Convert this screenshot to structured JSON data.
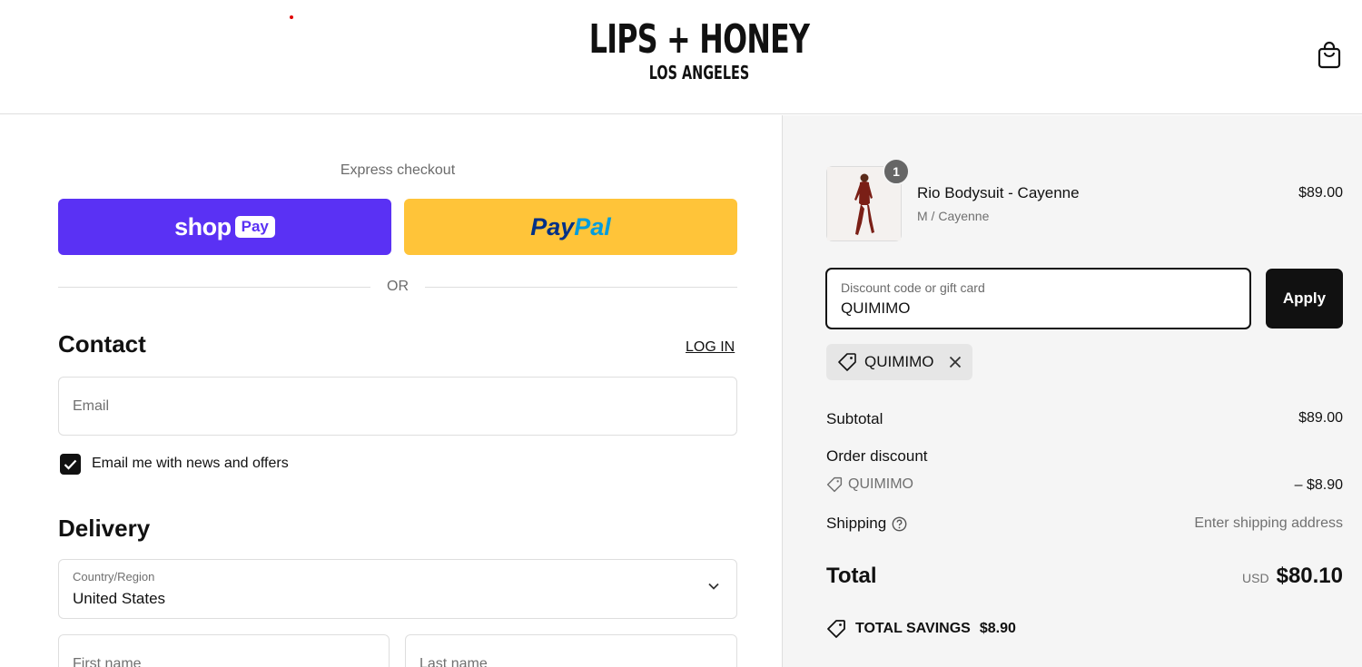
{
  "header": {
    "logo_main": "LIPS + HONEY",
    "logo_sub": "LOS ANGELES",
    "cart_icon": "shopping-bag-icon"
  },
  "express": {
    "label": "Express checkout",
    "shop_pay_text": "shop",
    "shop_pay_badge": "Pay",
    "paypal_part1": "Pay",
    "paypal_part2": "Pal",
    "or_text": "OR",
    "shop_pay_color": "#5a31f4",
    "paypal_color": "#ffc439"
  },
  "contact": {
    "title": "Contact",
    "login_label": "LOG IN",
    "email_placeholder": "Email",
    "newsletter_label": "Email me with news and offers",
    "newsletter_checked": true
  },
  "delivery": {
    "title": "Delivery",
    "country_label": "Country/Region",
    "country_value": "United States",
    "first_name_placeholder": "First name",
    "last_name_placeholder": "Last name"
  },
  "order": {
    "product": {
      "name": "Rio Bodysuit - Cayenne",
      "variant": "M / Cayenne",
      "price": "$89.00",
      "quantity": "1"
    },
    "discount_field": {
      "label": "Discount code or gift card",
      "value": "QUIMIMO"
    },
    "apply_label": "Apply",
    "applied_code": "QUIMIMO",
    "summary": {
      "subtotal_label": "Subtotal",
      "subtotal_value": "$89.00",
      "order_discount_label": "Order discount",
      "discount_code": "QUIMIMO",
      "discount_value": "– $8.90",
      "shipping_label": "Shipping",
      "shipping_value": "Enter shipping address",
      "total_label": "Total",
      "currency": "USD",
      "total_value": "$80.10",
      "savings_label": "TOTAL SAVINGS",
      "savings_value": "$8.90"
    }
  }
}
